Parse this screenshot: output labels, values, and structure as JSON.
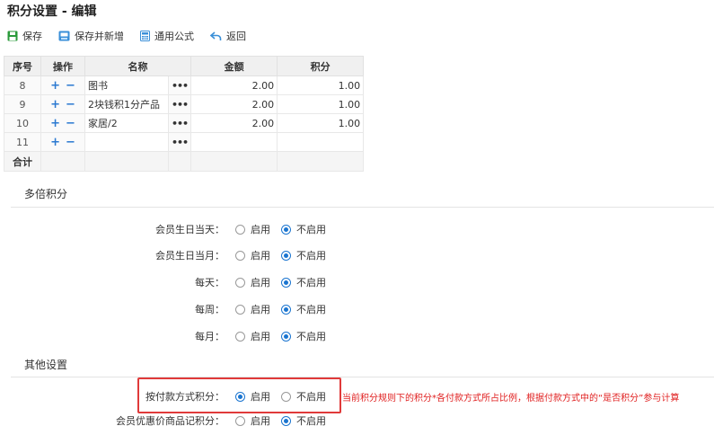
{
  "title": "积分设置 - 编辑",
  "toolbar": {
    "save": "保存",
    "save_new": "保存并新增",
    "formula": "通用公式",
    "back": "返回"
  },
  "table": {
    "headers": [
      "序号",
      "操作",
      "名称",
      "金额",
      "积分"
    ],
    "rows": [
      {
        "seq": "8",
        "name": "图书",
        "amount": "2.00",
        "points": "1.00"
      },
      {
        "seq": "9",
        "name": "2块钱积1分产品",
        "amount": "2.00",
        "points": "1.00"
      },
      {
        "seq": "10",
        "name": "家居/2",
        "amount": "2.00",
        "points": "1.00"
      },
      {
        "seq": "11",
        "name": "",
        "amount": "",
        "points": ""
      }
    ],
    "total_label": "合计",
    "dots": "•••"
  },
  "sections": {
    "multi": "多倍积分",
    "other": "其他设置"
  },
  "radio_labels": {
    "on": "启用",
    "off": "不启用"
  },
  "multi_rows": [
    {
      "label": "会员生日当天：",
      "selected": "off"
    },
    {
      "label": "会员生日当月：",
      "selected": "off"
    },
    {
      "label": "每天：",
      "selected": "off"
    },
    {
      "label": "每周：",
      "selected": "off"
    },
    {
      "label": "每月：",
      "selected": "off"
    }
  ],
  "other_rows": [
    {
      "label": "按付款方式积分：",
      "selected": "on"
    },
    {
      "label": "会员优惠价商品记积分：",
      "selected": "off"
    }
  ],
  "note": "当前积分规则下的积分*各付款方式所占比例，根据付款方式中的“是否积分”参与计算",
  "colors": {
    "accent": "#1b75d0",
    "highlight": "#e03a3a"
  }
}
